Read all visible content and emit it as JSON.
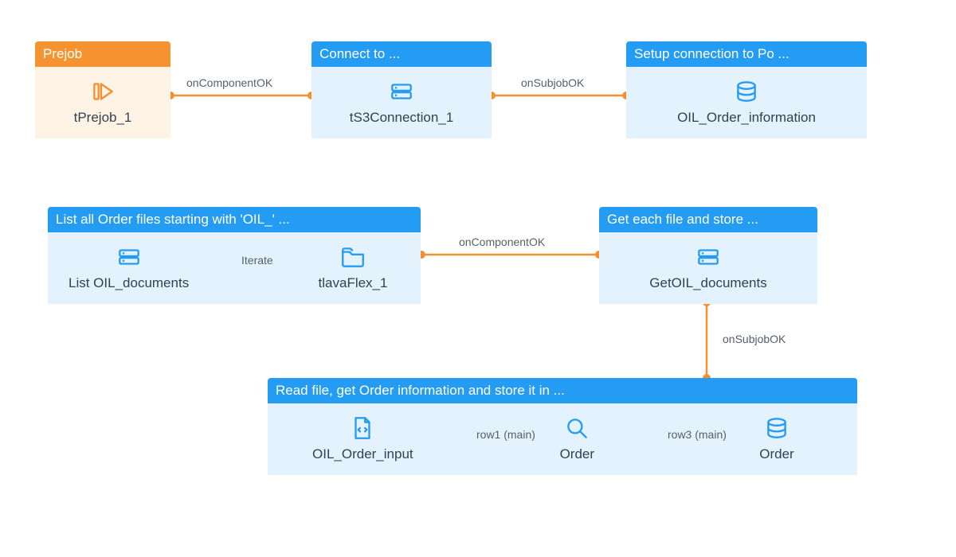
{
  "blocks": {
    "prejob": {
      "header": "Prejob",
      "comp": "tPrejob_1"
    },
    "connect": {
      "header": "Connect to ...",
      "comp": "tS3Connection_1"
    },
    "setup": {
      "header": "Setup connection to Po ...",
      "comp": "OIL_Order_information"
    },
    "listall": {
      "header": "List all Order files starting with 'OIL_' ...",
      "compA": "List OIL_documents",
      "compB": "tlavaFlex_1",
      "innerConn": "Iterate"
    },
    "geteach": {
      "header": "Get each file and store ...",
      "comp": "GetOIL_documents"
    },
    "readfile": {
      "header": "Read file, get Order information and store it in ...",
      "compA": "OIL_Order_input",
      "compB": "Order",
      "compC": "Order",
      "connAB": "row1 (main)",
      "connBC": "row3 (main)"
    }
  },
  "connectors": {
    "c1": "onComponentOK",
    "c2": "onSubjobOK",
    "c3": "onComponentOK",
    "c4": "onSubjobOK"
  }
}
